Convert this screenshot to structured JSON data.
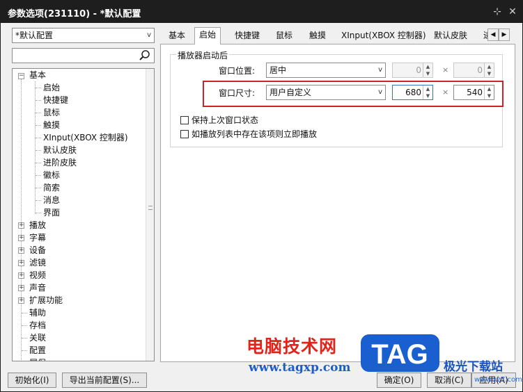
{
  "window": {
    "title": "参数选项(231110) - *默认配置"
  },
  "profile_select": {
    "value": "*默认配置"
  },
  "search": {
    "placeholder": ""
  },
  "tree": {
    "root": "基本",
    "children": [
      "启始",
      "快捷键",
      "鼠标",
      "触摸",
      "XInput(XBOX 控制器)",
      "默认皮肤",
      "进阶皮肤",
      "徽标",
      "简索",
      "消息",
      "界面"
    ],
    "collapsed": [
      "播放",
      "字幕",
      "设备",
      "滤镜",
      "视频",
      "声音",
      "扩展功能"
    ],
    "plain": [
      "辅助",
      "存档",
      "关联",
      "配置",
      "屏保"
    ]
  },
  "tabs": [
    "基本",
    "启始",
    "快捷键",
    "鼠标",
    "触摸",
    "XInput(XBOX 控制器)",
    "默认皮肤",
    "进"
  ],
  "active_tab": "启始",
  "group": {
    "title": "播放器启动后",
    "position_label": "窗口位置:",
    "position_value": "居中",
    "pos_x": "0",
    "pos_y": "0",
    "size_label": "窗口尺寸:",
    "size_value": "用户自定义",
    "width": "680",
    "height": "540",
    "times": "×"
  },
  "checkboxes": [
    "保持上次窗口状态",
    "如播放列表中存在该项则立即播放"
  ],
  "buttons": {
    "init": "初始化(I)",
    "export": "导出当前配置(S)...",
    "ok": "确定(O)",
    "cancel": "取消(C)",
    "apply": "应用(A)"
  },
  "watermark": {
    "cn": "电脑技术网",
    "url": "www.tagxp.com",
    "tag": "TAG",
    "site": "极光下载站",
    "site_url": "www.xz7.com"
  },
  "colors": {
    "highlight": "#d0202a",
    "titlebar": "#1e1e1e",
    "tag_blue": "#1a5fd0"
  }
}
